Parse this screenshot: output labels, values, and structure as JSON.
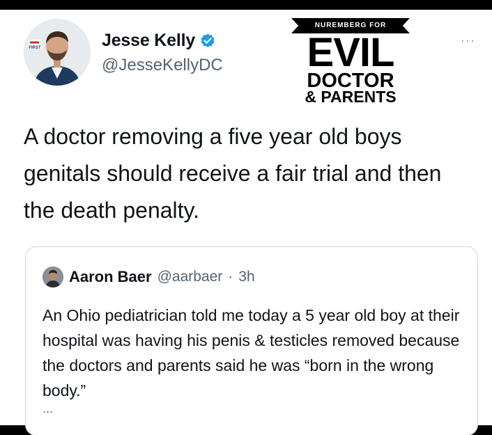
{
  "author": {
    "name": "Jesse Kelly",
    "handle": "@JesseKellyDC",
    "avatar_badge": "FIRST",
    "verified_color": "#1d9bf0"
  },
  "more_label": "···",
  "overlay": {
    "banner": "NUREMBERG FOR",
    "line1": "EVIL",
    "line2": "DOCTOR",
    "line3": "& PARENTS"
  },
  "tweet": {
    "text": "A doctor removing a five year old boys genitals should receive a fair trial and then the death penalty."
  },
  "quoted": {
    "name": "Aaron Baer",
    "handle": "@aarbaer",
    "dot": "·",
    "time": "3h",
    "text": "An Ohio pediatrician told me today a 5 year old boy at their hospital was having his penis & testicles removed because the doctors and parents said he was “born in the wrong body.”",
    "ellipsis": "..."
  }
}
